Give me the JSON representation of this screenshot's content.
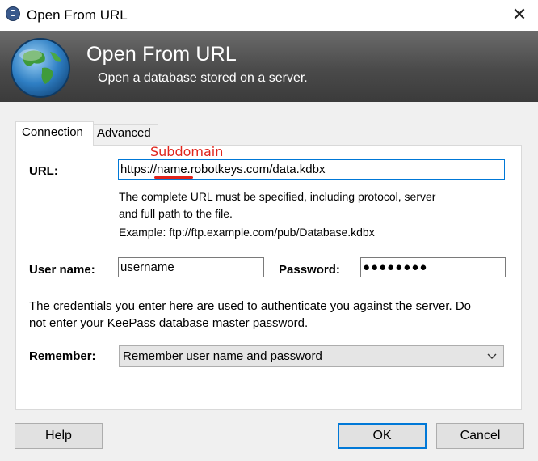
{
  "window": {
    "title": "Open From URL",
    "close_glyph": "✕"
  },
  "banner": {
    "title": "Open From URL",
    "subtitle": "Open a database stored on a server."
  },
  "tabs": [
    {
      "label": "Connection",
      "active": true
    },
    {
      "label": "Advanced",
      "active": false
    }
  ],
  "connection": {
    "url_label": "URL:",
    "url_value": "https://name.robotkeys.com/data.kdbx",
    "annotation": "Subdomain",
    "url_help_line1": "The complete URL must be specified, including protocol, server",
    "url_help_line2": "and full path to the file.",
    "url_example": "Example: ftp://ftp.example.com/pub/Database.kdbx",
    "username_label": "User name:",
    "username_value": "username",
    "password_label": "Password:",
    "password_value": "●●●●●●●●",
    "credentials_note_line1": "The credentials you enter here are used to authenticate you against the server. Do",
    "credentials_note_line2": "not enter your KeePass database master password.",
    "remember_label": "Remember:",
    "remember_value": "Remember user name and password"
  },
  "buttons": {
    "help": "Help",
    "ok": "OK",
    "cancel": "Cancel"
  },
  "colors": {
    "accent": "#0078d7",
    "annotation": "#e0241b",
    "banner": "#4a4a4a"
  }
}
